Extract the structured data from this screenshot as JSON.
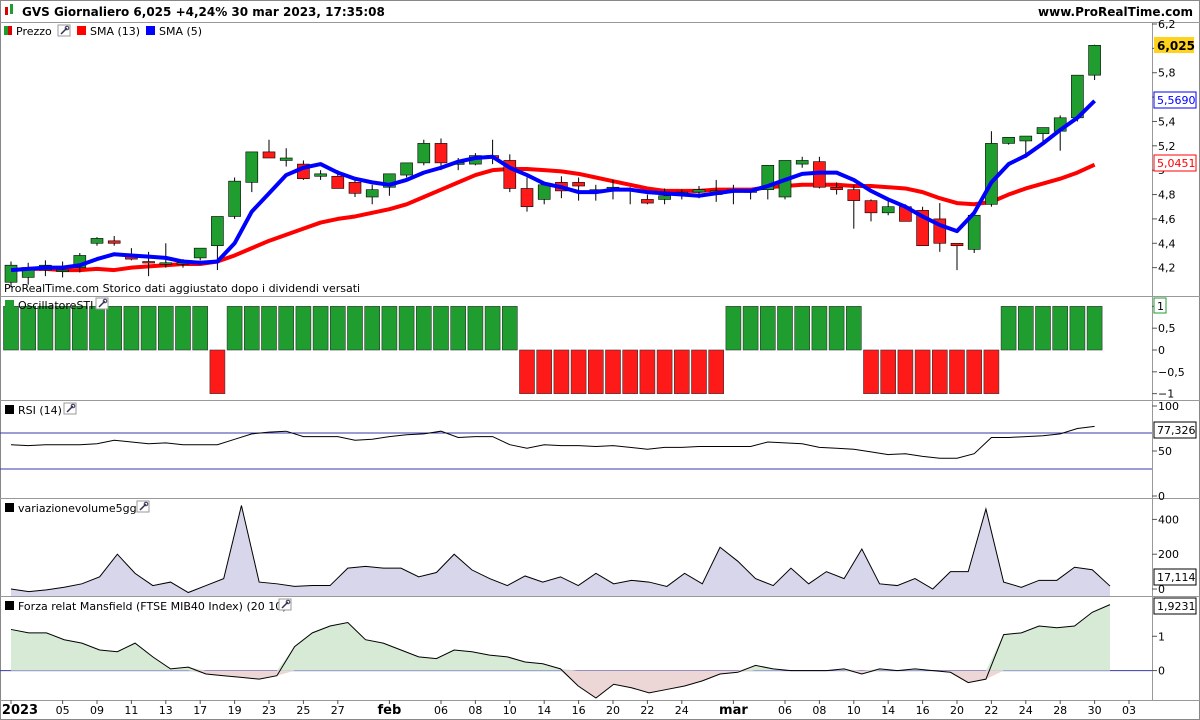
{
  "header": {
    "title": "GVS Giornaliero 6,025 +4,24% 30 mar 2023, 17:35:08",
    "site": "www.ProRealTime.com"
  },
  "main_panel": {
    "legend": [
      {
        "label": "Prezzo",
        "icon": "candle-icon"
      },
      {
        "label": "SMA (13)",
        "color": "#ff0000"
      },
      {
        "label": "SMA (5)",
        "color": "#0000ff"
      }
    ],
    "footnote": "ProRealTime.com  Storico dati aggiustato dopo i dividendi versati",
    "last_price_label": "6,025",
    "sma5_label": "5,5690",
    "sma13_label": "5,0451"
  },
  "sti_panel": {
    "title": "OscillatoreSTI",
    "value_label": "1"
  },
  "rsi_panel": {
    "title": "RSI (14)",
    "value_label": "77,326"
  },
  "vol_panel": {
    "title": "variazionevolume5gg",
    "value_label": "17,114"
  },
  "mansfield_panel": {
    "title": "Forza relat Mansfield (FTSE MIB40 Index) (20 10)",
    "value_label": "1,9231"
  },
  "colors": {
    "up": "#1f9e2f",
    "down": "#ff1a1a",
    "sma5": "#0000ff",
    "sma13": "#ff0000",
    "vol_fill": "#d8d6ea",
    "mans_pos": "#d6ead6",
    "mans_neg": "#ecd6d6"
  },
  "chart_data": [
    {
      "type": "candlestick",
      "title": "GVS Giornaliero",
      "x": [
        "2023-01-02",
        "2023-01-03",
        "2023-01-04",
        "2023-01-05",
        "2023-01-06",
        "2023-01-09",
        "2023-01-10",
        "2023-01-11",
        "2023-01-12",
        "2023-01-13",
        "2023-01-16",
        "2023-01-17",
        "2023-01-18",
        "2023-01-19",
        "2023-01-20",
        "2023-01-23",
        "2023-01-24",
        "2023-01-25",
        "2023-01-26",
        "2023-01-27",
        "2023-01-30",
        "2023-01-31",
        "2023-02-01",
        "2023-02-02",
        "2023-02-03",
        "2023-02-06",
        "2023-02-07",
        "2023-02-08",
        "2023-02-09",
        "2023-02-10",
        "2023-02-13",
        "2023-02-14",
        "2023-02-15",
        "2023-02-16",
        "2023-02-17",
        "2023-02-20",
        "2023-02-21",
        "2023-02-22",
        "2023-02-23",
        "2023-02-24",
        "2023-02-27",
        "2023-02-28",
        "2023-03-01",
        "2023-03-02",
        "2023-03-03",
        "2023-03-06",
        "2023-03-07",
        "2023-03-08",
        "2023-03-09",
        "2023-03-10",
        "2023-03-13",
        "2023-03-14",
        "2023-03-15",
        "2023-03-16",
        "2023-03-17",
        "2023-03-20",
        "2023-03-21",
        "2023-03-22",
        "2023-03-23",
        "2023-03-24",
        "2023-03-27",
        "2023-03-28",
        "2023-03-29",
        "2023-03-30"
      ],
      "open": [
        4.08,
        4.12,
        4.18,
        4.17,
        4.2,
        4.4,
        4.42,
        4.3,
        4.25,
        4.23,
        4.23,
        4.28,
        4.38,
        4.62,
        4.9,
        5.15,
        5.08,
        5.05,
        4.95,
        4.95,
        4.9,
        4.78,
        4.86,
        4.96,
        5.06,
        5.22,
        5.05,
        5.05,
        5.12,
        5.08,
        4.85,
        4.76,
        4.9,
        4.9,
        4.82,
        4.83,
        4.84,
        4.76,
        4.76,
        4.8,
        4.82,
        4.8,
        4.83,
        4.82,
        4.84,
        4.78,
        5.05,
        5.07,
        4.86,
        4.84,
        4.75,
        4.65,
        4.7,
        4.67,
        4.6,
        4.4,
        4.35,
        4.72,
        5.22,
        5.24,
        5.3,
        5.32,
        5.43,
        5.78
      ],
      "high": [
        4.25,
        4.24,
        4.26,
        4.25,
        4.32,
        4.45,
        4.46,
        4.36,
        4.33,
        4.4,
        4.27,
        4.36,
        4.41,
        4.94,
        5.0,
        5.25,
        5.18,
        5.08,
        5.0,
        5.0,
        4.92,
        4.88,
        4.88,
        5.0,
        5.25,
        5.26,
        5.1,
        5.14,
        5.25,
        5.13,
        4.94,
        4.88,
        4.95,
        4.94,
        4.88,
        4.92,
        4.86,
        4.8,
        4.85,
        4.84,
        4.87,
        4.92,
        4.88,
        4.84,
        4.87,
        5.07,
        5.11,
        5.11,
        4.9,
        4.88,
        4.76,
        4.75,
        4.72,
        4.7,
        4.73,
        4.4,
        4.64,
        5.32,
        5.27,
        5.27,
        5.34,
        5.45,
        5.7,
        6.03
      ],
      "low": [
        4.04,
        4.06,
        4.13,
        4.12,
        4.16,
        4.38,
        4.38,
        4.26,
        4.13,
        4.2,
        4.2,
        4.26,
        4.18,
        4.6,
        4.82,
        5.1,
        5.03,
        4.92,
        4.92,
        4.92,
        4.78,
        4.72,
        4.79,
        4.94,
        5.04,
        5.0,
        5.0,
        5.04,
        5.05,
        4.82,
        4.66,
        4.72,
        4.77,
        4.75,
        4.75,
        4.76,
        4.72,
        4.72,
        4.72,
        4.76,
        4.77,
        4.74,
        4.72,
        4.76,
        4.76,
        4.76,
        5.02,
        4.85,
        4.8,
        4.52,
        4.58,
        4.63,
        4.62,
        4.45,
        4.33,
        4.18,
        4.32,
        4.7,
        5.21,
        5.1,
        5.22,
        5.16,
        5.4,
        5.74
      ],
      "close": [
        4.22,
        4.2,
        4.22,
        4.18,
        4.3,
        4.44,
        4.4,
        4.27,
        4.24,
        4.24,
        4.24,
        4.36,
        4.62,
        4.91,
        5.15,
        5.1,
        5.1,
        4.93,
        4.97,
        4.85,
        4.81,
        4.84,
        4.97,
        5.06,
        5.22,
        5.06,
        5.06,
        5.12,
        5.1,
        4.85,
        4.7,
        4.88,
        4.83,
        4.87,
        4.84,
        4.86,
        4.83,
        4.73,
        4.79,
        4.82,
        4.84,
        4.83,
        4.84,
        4.83,
        5.04,
        5.08,
        5.08,
        4.86,
        4.84,
        4.75,
        4.65,
        4.7,
        4.58,
        4.38,
        4.4,
        4.38,
        4.63,
        5.22,
        5.27,
        5.28,
        5.35,
        5.43,
        5.78,
        6.025
      ],
      "sma13": [
        4.18,
        4.19,
        4.19,
        4.18,
        4.18,
        4.19,
        4.18,
        4.2,
        4.21,
        4.22,
        4.23,
        4.23,
        4.25,
        4.3,
        4.36,
        4.42,
        4.47,
        4.52,
        4.57,
        4.6,
        4.62,
        4.65,
        4.68,
        4.72,
        4.78,
        4.84,
        4.9,
        4.96,
        5.0,
        5.01,
        5.01,
        5.0,
        4.99,
        4.97,
        4.94,
        4.91,
        4.88,
        4.85,
        4.83,
        4.83,
        4.83,
        4.84,
        4.84,
        4.84,
        4.86,
        4.87,
        4.88,
        4.88,
        4.88,
        4.87,
        4.87,
        4.86,
        4.85,
        4.82,
        4.77,
        4.73,
        4.72,
        4.74,
        4.8,
        4.85,
        4.89,
        4.93,
        4.98,
        5.0451
      ],
      "sma5": [
        4.18,
        4.19,
        4.2,
        4.2,
        4.22,
        4.27,
        4.31,
        4.3,
        4.29,
        4.28,
        4.25,
        4.24,
        4.25,
        4.4,
        4.66,
        4.81,
        4.96,
        5.02,
        5.05,
        4.98,
        4.93,
        4.9,
        4.88,
        4.92,
        4.98,
        5.02,
        5.07,
        5.1,
        5.11,
        5.02,
        4.96,
        4.89,
        4.86,
        4.82,
        4.82,
        4.84,
        4.84,
        4.82,
        4.81,
        4.8,
        4.79,
        4.81,
        4.83,
        4.83,
        4.87,
        4.92,
        4.97,
        4.98,
        4.98,
        4.92,
        4.83,
        4.76,
        4.7,
        4.62,
        4.55,
        4.5,
        4.65,
        4.9,
        5.05,
        5.12,
        5.22,
        5.33,
        5.43,
        5.569
      ],
      "ylim": [
        4.0,
        6.2
      ],
      "yticks": [
        4.2,
        4.4,
        4.6,
        4.8,
        5.0,
        5.2,
        5.4,
        5.6,
        5.8,
        6.0,
        6.2
      ],
      "yticklabels": [
        "4,2",
        "4,4",
        "4,6",
        "4,8",
        "5",
        "5,2",
        "5,4",
        "5,6",
        "5,8",
        "6",
        "6,2"
      ]
    },
    {
      "type": "bar",
      "title": "OscillatoreSTI",
      "values": [
        1,
        1,
        1,
        1,
        1,
        1,
        1,
        1,
        1,
        1,
        1,
        1,
        -1,
        1,
        1,
        1,
        1,
        1,
        1,
        1,
        1,
        1,
        1,
        1,
        1,
        1,
        1,
        1,
        1,
        1,
        -1,
        -1,
        -1,
        -1,
        -1,
        -1,
        -1,
        -1,
        -1,
        -1,
        -1,
        -1,
        1,
        1,
        1,
        1,
        1,
        1,
        1,
        1,
        -1,
        -1,
        -1,
        -1,
        -1,
        -1,
        -1,
        -1,
        1,
        1,
        1,
        1,
        1,
        1,
        1
      ],
      "ylim": [
        -1.1,
        1.1
      ],
      "yticks": [
        1,
        0.5,
        0,
        -0.5,
        -1
      ],
      "yticklabels": [
        "1",
        "0,5",
        "0",
        "−0,5",
        "−1"
      ]
    },
    {
      "type": "line",
      "title": "RSI (14)",
      "values": [
        57,
        56,
        57,
        57,
        57,
        58,
        62,
        60,
        58,
        59,
        57,
        57,
        57,
        63,
        69,
        71,
        72,
        66,
        66,
        66,
        62,
        63,
        66,
        68,
        69,
        72,
        65,
        66,
        66,
        57,
        53,
        57,
        56,
        56,
        55,
        56,
        54,
        52,
        54,
        54,
        55,
        55,
        55,
        55,
        60,
        59,
        58,
        54,
        53,
        52,
        49,
        46,
        47,
        44,
        42,
        42,
        47,
        65,
        65,
        66,
        67,
        69,
        75,
        77.326
      ],
      "ylim": [
        0,
        100
      ],
      "hlines": [
        70,
        30
      ],
      "yticks": [
        100,
        50,
        0
      ],
      "yticklabels": [
        "100",
        "50",
        "0"
      ]
    },
    {
      "type": "area",
      "title": "variazionevolume5gg",
      "values": [
        0,
        -15,
        -5,
        10,
        30,
        70,
        200,
        90,
        20,
        40,
        -20,
        20,
        60,
        480,
        40,
        30,
        15,
        20,
        20,
        120,
        130,
        120,
        120,
        70,
        95,
        200,
        110,
        60,
        20,
        75,
        40,
        70,
        20,
        90,
        30,
        50,
        40,
        15,
        90,
        30,
        240,
        160,
        60,
        20,
        120,
        30,
        100,
        60,
        230,
        30,
        20,
        60,
        0,
        100,
        100,
        460,
        40,
        10,
        50,
        50,
        125,
        111,
        17.114
      ],
      "ylim": [
        -40,
        500
      ],
      "yticks": [
        400,
        200,
        0
      ],
      "yticklabels": [
        "400",
        "200",
        "0"
      ]
    },
    {
      "type": "area",
      "title": "Forza relat Mansfield (FTSE MIB40 Index) (20 10)",
      "values": [
        1.2,
        1.1,
        1.1,
        0.9,
        0.8,
        0.6,
        0.55,
        0.8,
        0.4,
        0.05,
        0.1,
        -0.1,
        -0.15,
        -0.2,
        -0.25,
        -0.15,
        0.7,
        1.1,
        1.3,
        1.4,
        0.9,
        0.8,
        0.6,
        0.4,
        0.35,
        0.6,
        0.55,
        0.45,
        0.4,
        0.25,
        0.2,
        0.05,
        -0.45,
        -0.8,
        -0.4,
        -0.5,
        -0.65,
        -0.55,
        -0.45,
        -0.3,
        -0.1,
        -0.05,
        0.15,
        0.05,
        0.0,
        0.0,
        0.0,
        0.05,
        -0.1,
        0.05,
        0.0,
        0.05,
        0.0,
        -0.05,
        -0.35,
        -0.25,
        1.05,
        1.1,
        1.3,
        1.25,
        1.3,
        1.7,
        1.9231
      ],
      "ylim": [
        -0.8,
        2.0
      ],
      "yticks": [
        1,
        0
      ],
      "yticklabels": [
        "1",
        "0"
      ]
    }
  ],
  "x_axis": {
    "labels": [
      {
        "label": "2023",
        "x": "2023-01-02",
        "bold": true
      },
      {
        "label": "05",
        "x": "2023-01-05"
      },
      {
        "label": "09",
        "x": "2023-01-09"
      },
      {
        "label": "11",
        "x": "2023-01-11"
      },
      {
        "label": "13",
        "x": "2023-01-13"
      },
      {
        "label": "17",
        "x": "2023-01-17"
      },
      {
        "label": "19",
        "x": "2023-01-19"
      },
      {
        "label": "23",
        "x": "2023-01-23"
      },
      {
        "label": "25",
        "x": "2023-01-25"
      },
      {
        "label": "27",
        "x": "2023-01-27"
      },
      {
        "label": "feb",
        "x": "2023-02-01",
        "bold": true
      },
      {
        "label": "06",
        "x": "2023-02-06"
      },
      {
        "label": "08",
        "x": "2023-02-08"
      },
      {
        "label": "10",
        "x": "2023-02-10"
      },
      {
        "label": "14",
        "x": "2023-02-14"
      },
      {
        "label": "16",
        "x": "2023-02-16"
      },
      {
        "label": "20",
        "x": "2023-02-20"
      },
      {
        "label": "22",
        "x": "2023-02-22"
      },
      {
        "label": "24",
        "x": "2023-02-24"
      },
      {
        "label": "mar",
        "x": "2023-03-01",
        "bold": true
      },
      {
        "label": "06",
        "x": "2023-03-06"
      },
      {
        "label": "08",
        "x": "2023-03-08"
      },
      {
        "label": "10",
        "x": "2023-03-10"
      },
      {
        "label": "14",
        "x": "2023-03-14"
      },
      {
        "label": "16",
        "x": "2023-03-16"
      },
      {
        "label": "20",
        "x": "2023-03-20"
      },
      {
        "label": "22",
        "x": "2023-03-22"
      },
      {
        "label": "24",
        "x": "2023-03-24"
      },
      {
        "label": "28",
        "x": "2023-03-28"
      },
      {
        "label": "30",
        "x": "2023-03-30"
      },
      {
        "label": "03",
        "x": "2023-04-03"
      }
    ]
  }
}
